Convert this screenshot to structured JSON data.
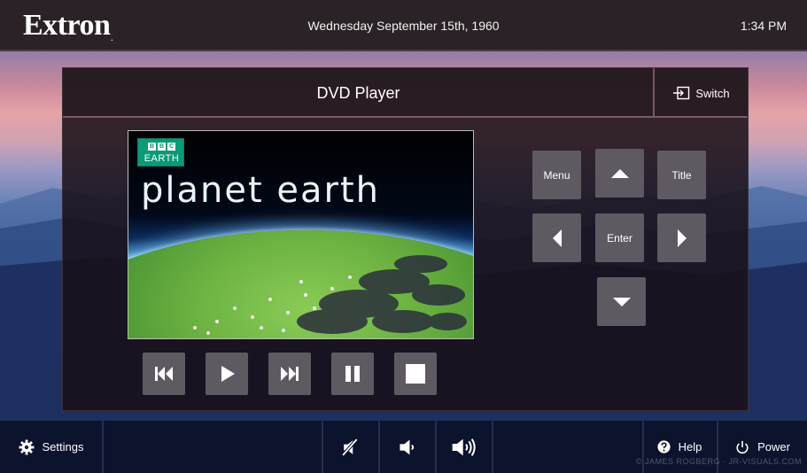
{
  "header": {
    "logo": "Extron",
    "logo_mark": ".",
    "date": "Wednesday September 15th, 1960",
    "time": "1:34 PM"
  },
  "panel": {
    "title": "DVD Player",
    "switch_label": "Switch"
  },
  "video": {
    "badge_letters": [
      "B",
      "B",
      "C"
    ],
    "badge_label": "EARTH",
    "title": "planet earth"
  },
  "transport": {
    "icons": [
      "skip-back-icon",
      "play-icon",
      "skip-forward-icon",
      "pause-icon",
      "stop-icon"
    ]
  },
  "nav": {
    "menu_label": "Menu",
    "title_label": "Title",
    "enter_label": "Enter"
  },
  "footer": {
    "settings_label": "Settings",
    "help_label": "Help",
    "power_label": "Power",
    "copyright": "© JAMES ROGBERG · JR-VISUALS.COM"
  },
  "colors": {
    "button": "#5f5a62",
    "panel_accent": "#7d5764",
    "header_bg": "#2a2226"
  }
}
